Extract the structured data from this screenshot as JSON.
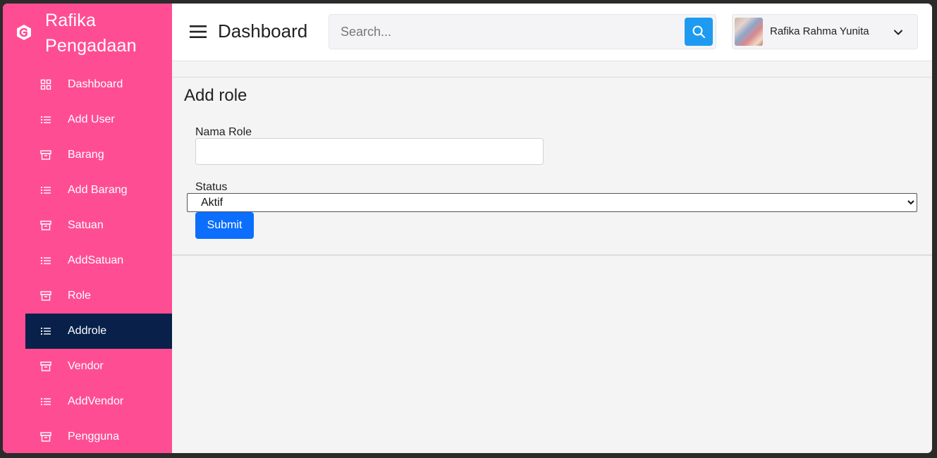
{
  "brand": {
    "name_line1": "Rafika",
    "name_line2": "Pengadaan",
    "icon": "brand-logo-icon"
  },
  "sidebar": {
    "items": [
      {
        "label": "Dashboard",
        "icon": "grid-icon",
        "active": false
      },
      {
        "label": "Add User",
        "icon": "list-icon",
        "active": false
      },
      {
        "label": "Barang",
        "icon": "archive-icon",
        "active": false
      },
      {
        "label": "Add Barang",
        "icon": "list-icon",
        "active": false
      },
      {
        "label": "Satuan",
        "icon": "archive-icon",
        "active": false
      },
      {
        "label": "AddSatuan",
        "icon": "list-icon",
        "active": false
      },
      {
        "label": "Role",
        "icon": "archive-icon",
        "active": false
      },
      {
        "label": "Addrole",
        "icon": "list-icon",
        "active": true
      },
      {
        "label": "Vendor",
        "icon": "archive-icon",
        "active": false
      },
      {
        "label": "AddVendor",
        "icon": "list-icon",
        "active": false
      },
      {
        "label": "Pengguna",
        "icon": "archive-icon",
        "active": false
      }
    ]
  },
  "header": {
    "title": "Dashboard",
    "search_placeholder": "Search...",
    "search_value": "",
    "user_name": "Rafika Rahma Yunita"
  },
  "form": {
    "title": "Add role",
    "role_label": "Nama Role",
    "role_value": "",
    "status_label": "Status",
    "status_selected": "Aktif",
    "submit_label": "Submit"
  },
  "colors": {
    "sidebar_bg": "#ff4d94",
    "sidebar_active_bg": "#08204a",
    "search_button": "#1e9bf0",
    "submit_button": "#0b6efd"
  }
}
